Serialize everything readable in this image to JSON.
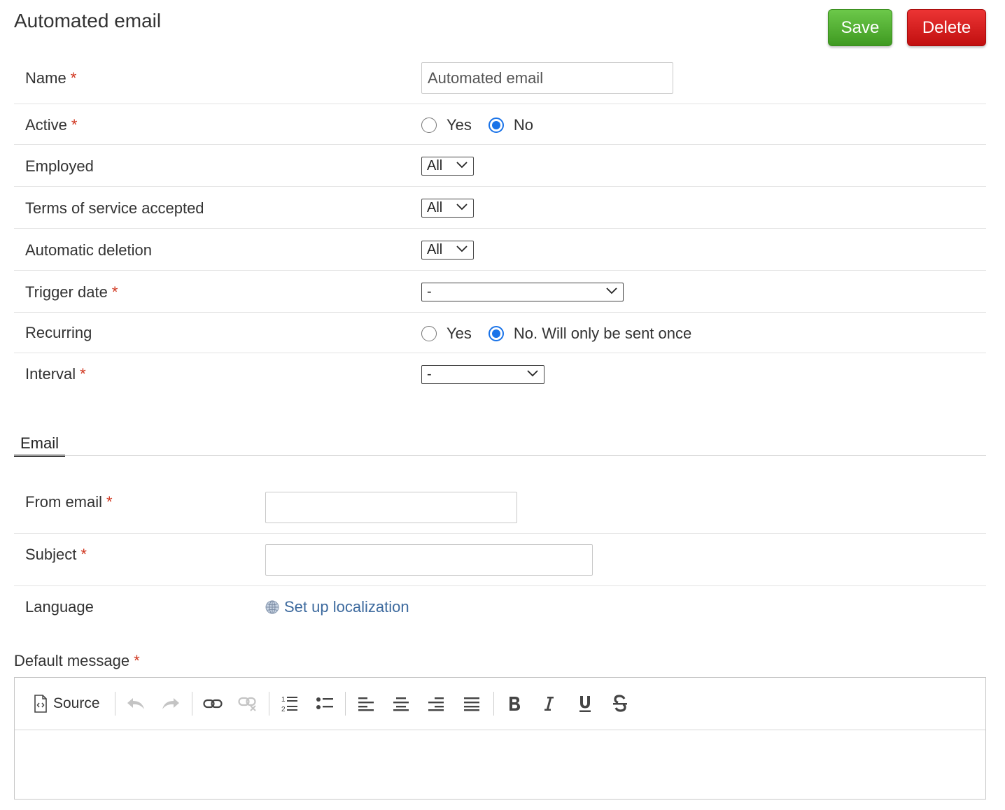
{
  "page": {
    "title": "Automated email",
    "save_label": "Save",
    "delete_label": "Delete"
  },
  "form": {
    "name": {
      "label": "Name",
      "value": "Automated email"
    },
    "active": {
      "label": "Active",
      "options": [
        "Yes",
        "No"
      ],
      "selected": "No"
    },
    "employed": {
      "label": "Employed",
      "selected": "All"
    },
    "terms": {
      "label": "Terms of service accepted",
      "selected": "All"
    },
    "auto_deletion": {
      "label": "Automatic deletion",
      "selected": "All"
    },
    "trigger_date": {
      "label": "Trigger date",
      "selected": "-"
    },
    "recurring": {
      "label": "Recurring",
      "options": [
        "Yes",
        "No. Will only be sent once"
      ],
      "selected": "No. Will only be sent once"
    },
    "interval": {
      "label": "Interval",
      "selected": "-"
    },
    "required_mark": "*"
  },
  "email_tab": {
    "label": "Email"
  },
  "email": {
    "from": {
      "label": "From email",
      "value": ""
    },
    "subject": {
      "label": "Subject",
      "value": ""
    },
    "language": {
      "label": "Language",
      "link": "Set up localization"
    },
    "default_message": {
      "label": "Default message"
    }
  },
  "editor": {
    "source_label": "Source",
    "icons": [
      "source-icon",
      "undo-icon",
      "redo-icon",
      "link-icon",
      "unlink-icon",
      "numbered-list-icon",
      "bulleted-list-icon",
      "align-left-icon",
      "align-center-icon",
      "align-right-icon",
      "align-justify-icon",
      "bold-icon",
      "italic-icon",
      "underline-icon",
      "strikethrough-icon"
    ]
  },
  "colors": {
    "save": "#4caf2a",
    "delete": "#d51d1d",
    "required": "#d0361f",
    "radio_checked": "#1a73e8",
    "link": "#3d6a9e"
  }
}
